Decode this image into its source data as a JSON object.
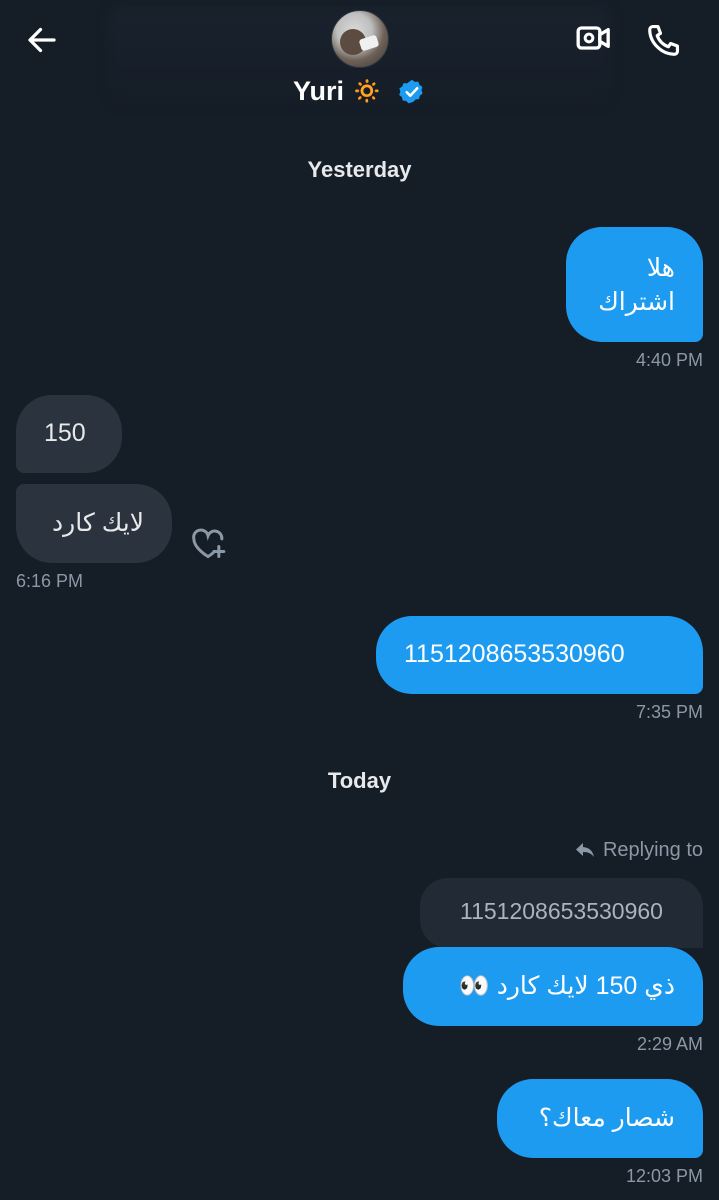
{
  "header": {
    "contact_name": "Yuri",
    "name_emoji": "🔅",
    "verified": true,
    "accent_color": "#1d9bf0"
  },
  "icons": {
    "back": "arrow-left-icon",
    "video": "video-camera-icon",
    "phone": "phone-icon",
    "react": "heart-plus-icon",
    "reply": "reply-arrow-icon",
    "verified": "verified-badge-icon"
  },
  "days": {
    "yesterday": "Yesterday",
    "today": "Today"
  },
  "messages": [
    {
      "direction": "sent",
      "lines": [
        "هلا",
        "اشتراك"
      ],
      "time": "4:40 PM"
    },
    {
      "direction": "received",
      "text": "150"
    },
    {
      "direction": "received",
      "text": "لايك كارد",
      "time": "6:16 PM"
    },
    {
      "direction": "sent",
      "text": "1151208653530960",
      "time": "7:35 PM"
    },
    {
      "direction": "sent",
      "replying_label": "Replying to",
      "quoted": "1151208653530960",
      "text": "ذي 150 لايك كارد 👀",
      "time": "2:29 AM"
    },
    {
      "direction": "sent",
      "text": "شصار معاك؟",
      "time": "12:03 PM"
    }
  ]
}
